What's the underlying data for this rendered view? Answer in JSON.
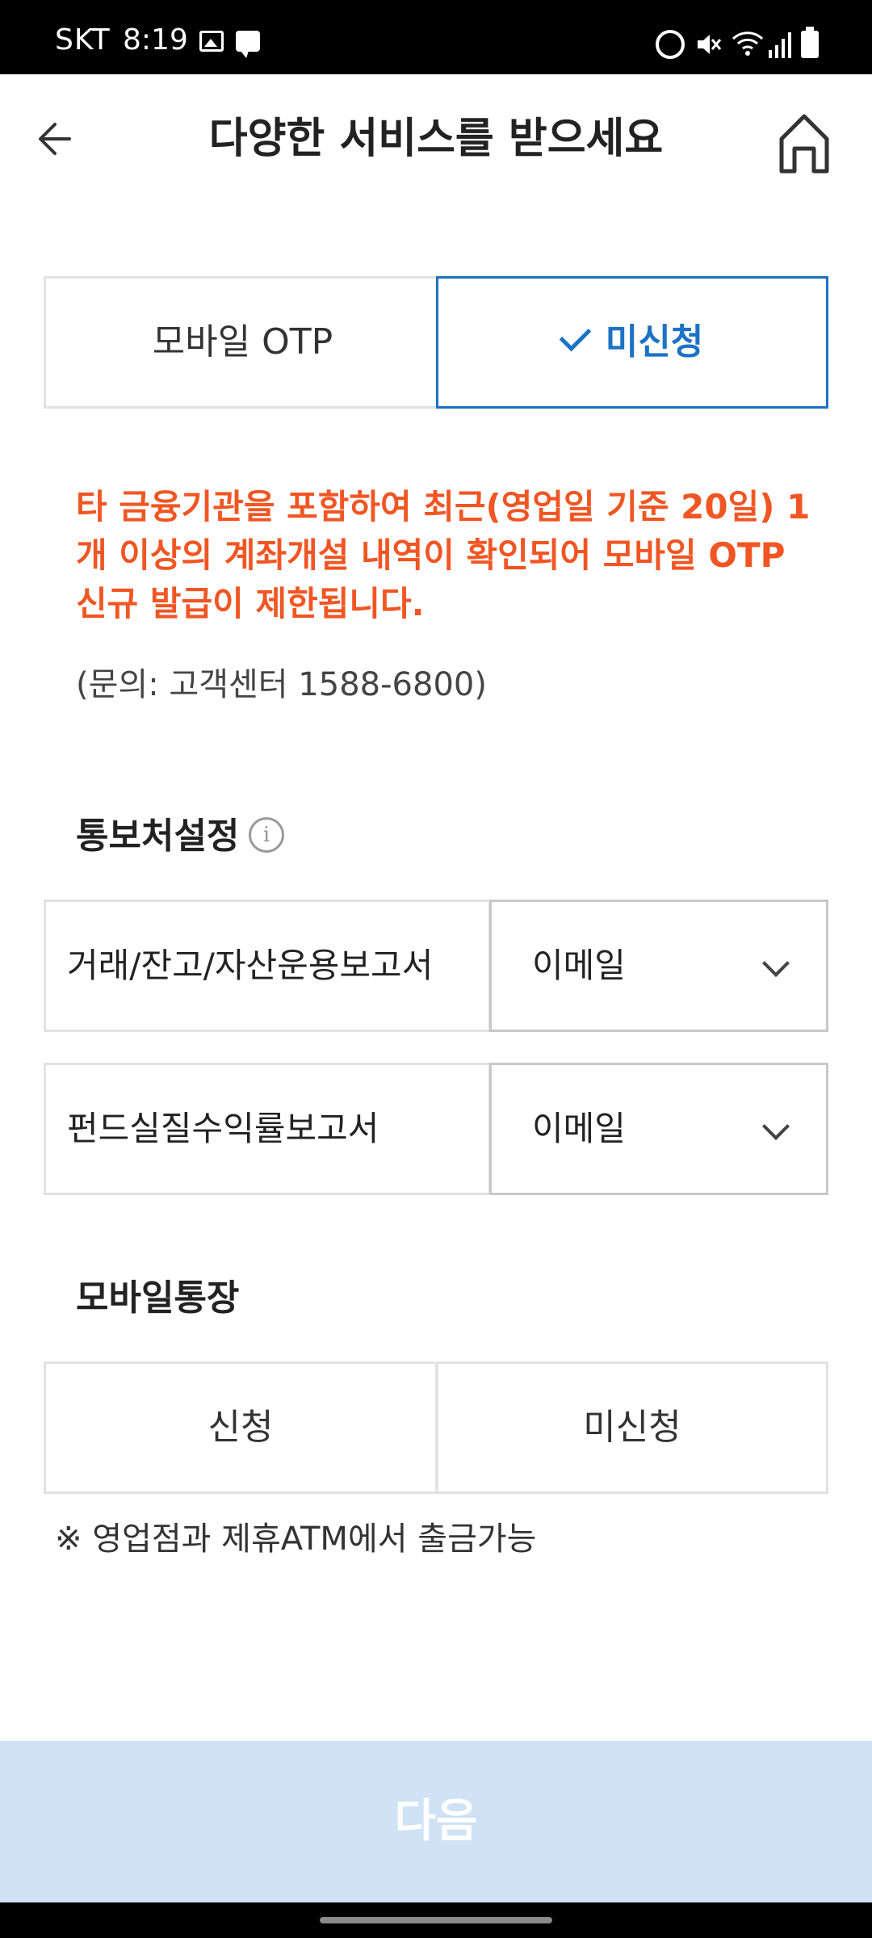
{
  "status_bar": {
    "carrier": "SKT",
    "time": "8:19"
  },
  "header": {
    "title": "다양한 서비스를 받으세요"
  },
  "otp_segment": {
    "left_label": "모바일 OTP",
    "right_label": "미신청",
    "selected": "right"
  },
  "warning_text": "타 금융기관을 포함하여 최근(영업일 기준 20일) 1개 이상의 계좌개설 내역이 확인되어 모바일 OTP 신규 발급이 제한됩니다.",
  "inquiry_text": "(문의: 고객센터 1588-6800)",
  "notify": {
    "title": "통보처설정",
    "rows": [
      {
        "label": "거래/잔고/자산운용보고서",
        "value": "이메일"
      },
      {
        "label": "펀드실질수익률보고서",
        "value": "이메일"
      }
    ]
  },
  "passbook": {
    "title": "모바일통장",
    "options": [
      "신청",
      "미신청"
    ]
  },
  "note": "※ 영업점과 제휴ATM에서 출금가능",
  "next_button": "다음",
  "colors": {
    "accent": "#1c72c4",
    "warning": "#f05623",
    "disabled_button": "#cfe2f6"
  }
}
